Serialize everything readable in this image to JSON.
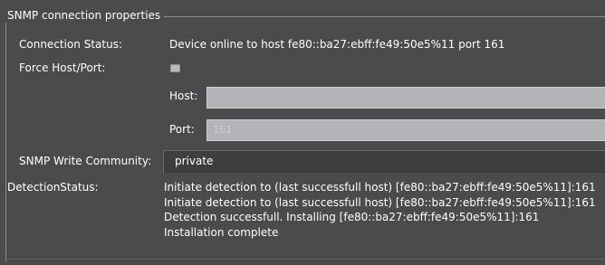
{
  "group": {
    "title": "SNMP connection properties"
  },
  "connection_status": {
    "label": "Connection Status:",
    "value": "Device online to host fe80::ba27:ebff:fe49:50e5%11 port 161"
  },
  "force_host_port": {
    "label": "Force Host/Port:",
    "checked": false,
    "host": {
      "label": "Host:",
      "value": ""
    },
    "port": {
      "label": "Port:",
      "value": "161"
    }
  },
  "write_community": {
    "label": "SNMP Write Community:",
    "value": "private"
  },
  "detection_status": {
    "label": "DetectionStatus:",
    "lines": [
      "Initiate detection to (last successfull host) [fe80::ba27:ebff:fe49:50e5%11]:161",
      "Initiate detection to (last successfull host) [fe80::ba27:ebff:fe49:50e5%11]:161",
      "Detection successfull. Installing [fe80::ba27:ebff:fe49:50e5%11]:161",
      "Installation complete"
    ]
  },
  "colors": {
    "panel_background": "#4a4b4d",
    "field_background": "#b3b4b7",
    "text": "#ffffff"
  }
}
